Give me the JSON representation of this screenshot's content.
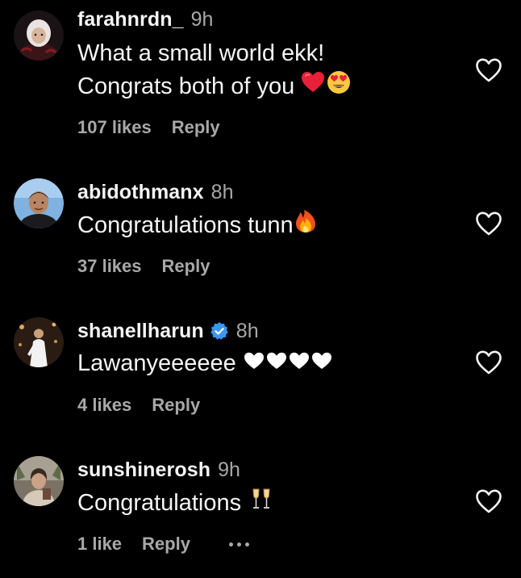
{
  "colors": {
    "background": "#000000",
    "primary_text": "#f5f5f5",
    "secondary_text": "#a8a8a8",
    "verified_blue": "#3897f0",
    "heart_red": "#e8213b"
  },
  "comments": [
    {
      "username": "farahnrdn_",
      "time": "9h",
      "text_lines": [
        "What a small world ekk!",
        "Congrats both of you"
      ],
      "emojis": [
        "red-heart-emoji",
        "heart-eyes-emoji"
      ],
      "likes": "107 likes",
      "reply": "Reply",
      "like_icon": "heart-outline-icon"
    },
    {
      "username": "abidothmanx",
      "time": "8h",
      "text_lines": [
        "Congratulations tunn"
      ],
      "emojis": [
        "fire-emoji"
      ],
      "likes": "37 likes",
      "reply": "Reply",
      "like_icon": "heart-outline-icon"
    },
    {
      "username": "shanellharun",
      "verified": true,
      "time": "8h",
      "text_lines": [
        "Lawanyeeeeee"
      ],
      "emojis": [
        "black-heart-emoji",
        "black-heart-emoji",
        "black-heart-emoji",
        "black-heart-emoji"
      ],
      "likes": "4 likes",
      "reply": "Reply",
      "like_icon": "heart-outline-icon"
    },
    {
      "username": "sunshinerosh",
      "time": "9h",
      "text_lines": [
        "Congratulations"
      ],
      "emojis": [
        "champagne-glasses-emoji"
      ],
      "likes": "1 like",
      "reply": "Reply",
      "more_icon": "more-options-icon",
      "like_icon": "heart-outline-icon"
    }
  ]
}
